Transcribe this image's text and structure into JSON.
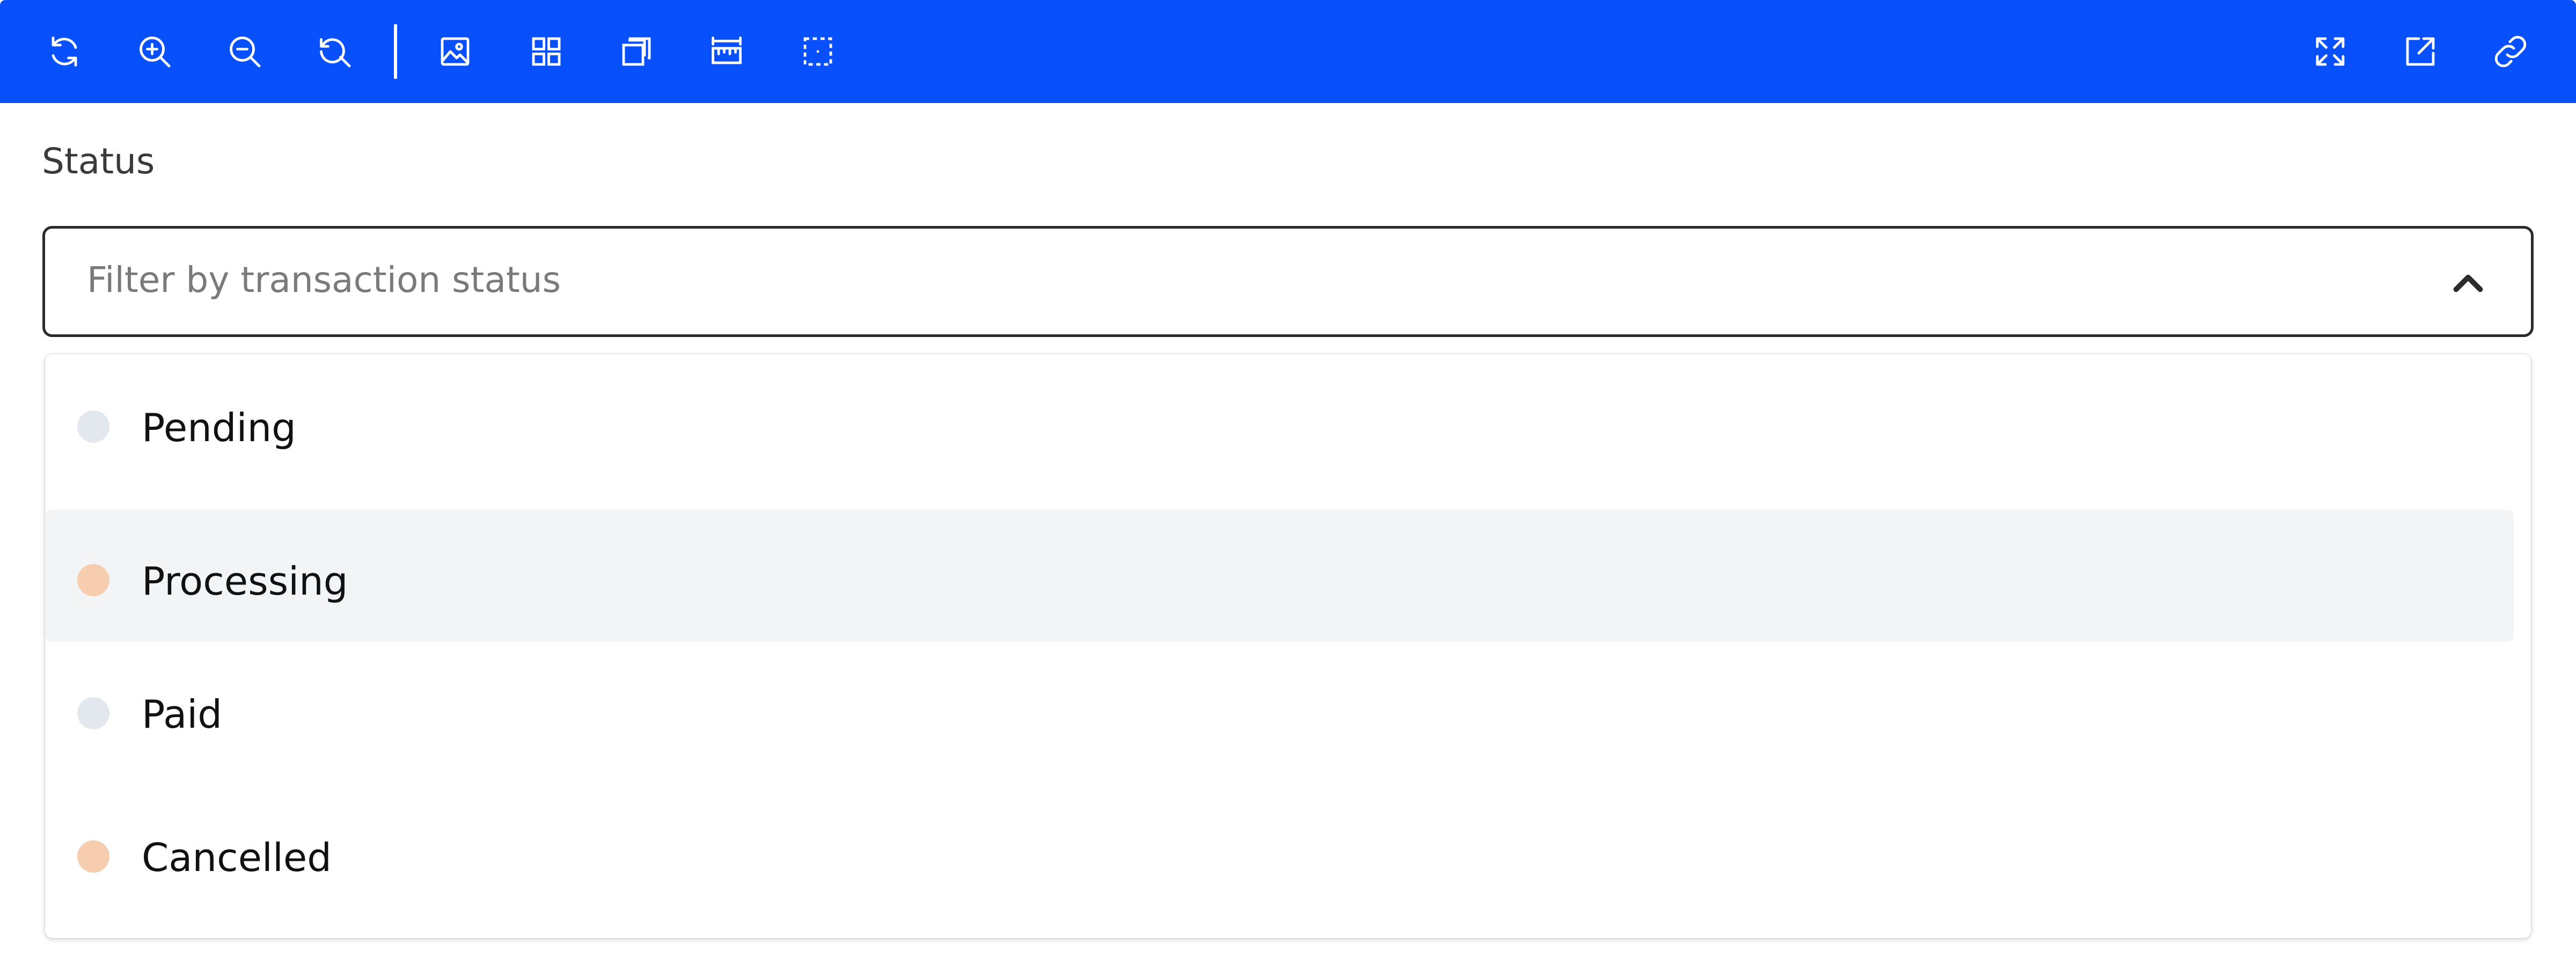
{
  "toolbar": {
    "left_tools": [
      {
        "icon": "refresh-icon"
      },
      {
        "icon": "zoom-in-icon"
      },
      {
        "icon": "zoom-out-icon"
      },
      {
        "icon": "reset-zoom-icon"
      },
      {
        "icon": "image-icon"
      },
      {
        "icon": "grid-icon"
      },
      {
        "icon": "layers-icon"
      },
      {
        "icon": "ruler-icon"
      },
      {
        "icon": "select-area-icon"
      }
    ],
    "right_tools": [
      {
        "icon": "fullscreen-icon"
      },
      {
        "icon": "open-external-icon"
      },
      {
        "icon": "copy-link-icon"
      }
    ],
    "color": "#0750fb"
  },
  "status_filter": {
    "label": "Status",
    "placeholder": "Filter by transaction status",
    "expanded": true,
    "options": [
      {
        "label": "Pending",
        "dot_color": "#e3e8ee",
        "highlighted": false
      },
      {
        "label": "Processing",
        "dot_color": "#f7cdb0",
        "highlighted": true
      },
      {
        "label": "Paid",
        "dot_color": "#e3e8ee",
        "highlighted": false
      },
      {
        "label": "Cancelled",
        "dot_color": "#f7cdb0",
        "highlighted": false
      }
    ]
  }
}
